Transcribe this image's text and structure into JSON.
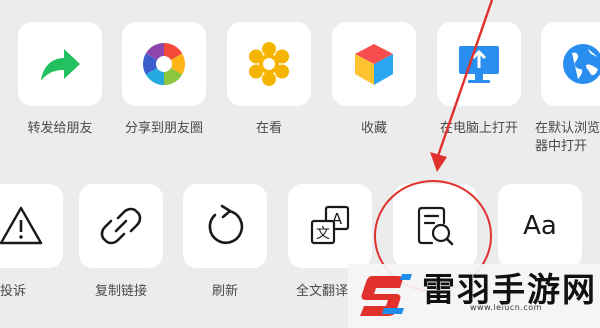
{
  "row1": [
    {
      "label": "转发给朋友",
      "icon": "forward-arrow-icon"
    },
    {
      "label": "分享到朋友圈",
      "icon": "moments-aperture-icon"
    },
    {
      "label": "在看",
      "icon": "wow-star-icon"
    },
    {
      "label": "收藏",
      "icon": "favorites-cube-icon"
    },
    {
      "label": "在电脑上打开",
      "icon": "computer-open-icon"
    },
    {
      "label": "在默认浏览器中打开",
      "icon": "browser-globe-icon"
    }
  ],
  "row2": [
    {
      "label": "投诉",
      "icon": "warning-icon"
    },
    {
      "label": "复制链接",
      "icon": "link-icon"
    },
    {
      "label": "刷新",
      "icon": "refresh-icon"
    },
    {
      "label": "全文翻译",
      "icon": "translate-icon"
    },
    {
      "label": "",
      "icon": "search-in-page-icon"
    },
    {
      "label": "",
      "icon": "font-size-icon",
      "text": "Aa"
    }
  ],
  "watermark": {
    "brand": "雷羽手游网",
    "url": "www.leiucn.com"
  },
  "colors": {
    "background": "#ececec",
    "tile": "#ffffff",
    "annotation": "#e0312c",
    "forward": "#22c05f"
  }
}
